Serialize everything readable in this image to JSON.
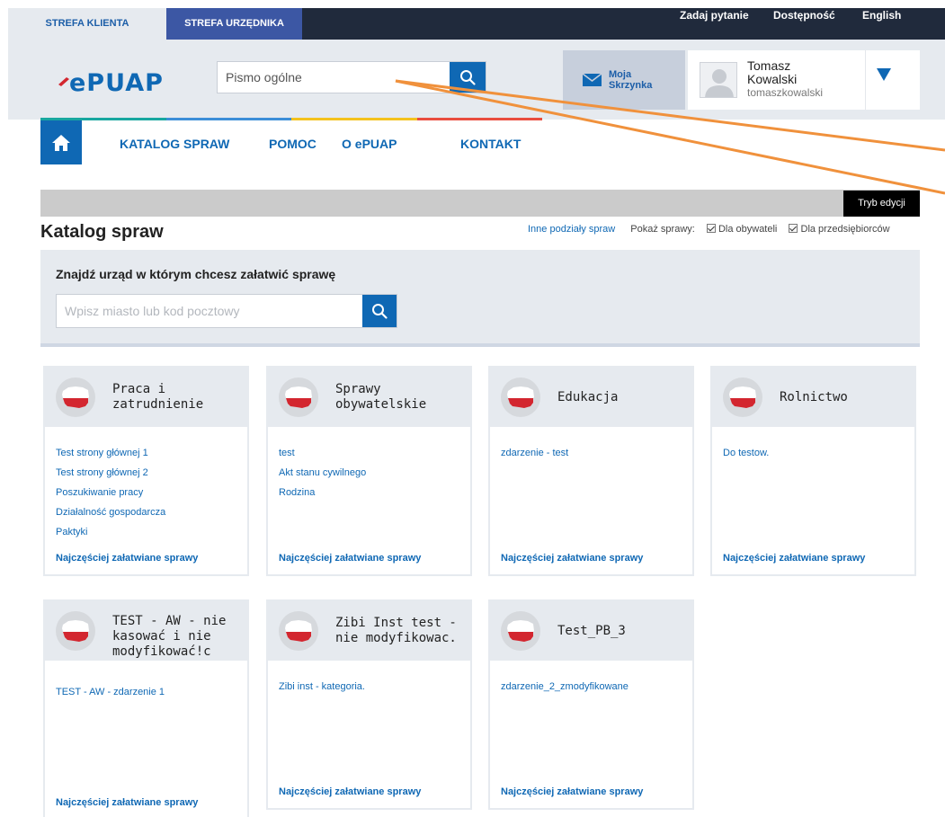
{
  "zones": {
    "klient": "STREFA KLIENTA",
    "urzednik": "STREFA URZĘDNIKA"
  },
  "top_links": {
    "ask": "Zadaj pytanie",
    "accessibility": "Dostępność",
    "english": "English"
  },
  "search": {
    "placeholder": "Pismo ogólne"
  },
  "mailbox": {
    "line1": "Moja",
    "line2": "Skrzynka"
  },
  "user": {
    "first_name": "Tomasz",
    "last_name": "Kowalski",
    "login": "tomaszkowalski"
  },
  "nav": {
    "catalog": "KATALOG SPRAW",
    "help": "POMOC",
    "about": "O ePUAP",
    "contact": "KONTAKT"
  },
  "edit_mode": "Tryb edycji",
  "page_title": "Katalog spraw",
  "filters": {
    "other": "Inne podziały spraw",
    "show": "Pokaż sprawy:",
    "citizens": "Dla obywateli",
    "business": "Dla przedsiębiorców"
  },
  "finder": {
    "title": "Znajdź urząd w którym chcesz załatwić sprawę",
    "placeholder": "Wpisz miasto lub kod pocztowy"
  },
  "colors": {
    "primary": "#0f68b4",
    "topbar": "#202a3c",
    "header": "#e6eaef",
    "flag_red": "#d3262f",
    "arrow": "#f0913c"
  },
  "cards": [
    {
      "title": "Praca i zatrudnienie",
      "links": [
        "Test strony głównej 1",
        "Test strony głównej 2",
        "Poszukiwanie pracy",
        "Działalność gospodarcza",
        "Paktyki"
      ],
      "footer": "Najczęściej załatwiane sprawy"
    },
    {
      "title": "Sprawy obywatelskie",
      "links": [
        "test",
        "Akt stanu cywilnego",
        "Rodzina"
      ],
      "footer": "Najczęściej załatwiane sprawy"
    },
    {
      "title": "Edukacja",
      "links": [
        "zdarzenie - test"
      ],
      "footer": "Najczęściej załatwiane sprawy"
    },
    {
      "title": "Rolnictwo",
      "links": [
        "Do testow."
      ],
      "footer": "Najczęściej załatwiane sprawy"
    },
    {
      "title": "TEST - AW - nie kasować i nie modyfikować!c",
      "links": [
        "TEST - AW - zdarzenie 1"
      ],
      "footer": "Najczęściej załatwiane sprawy"
    },
    {
      "title": "Zibi Inst test - nie modyfikowac.",
      "links": [
        "Zibi inst - kategoria."
      ],
      "footer": "Najczęściej załatwiane sprawy"
    },
    {
      "title": "Test_PB_3",
      "links": [
        "zdarzenie_2_zmodyfikowane"
      ],
      "footer": "Najczęściej załatwiane sprawy"
    }
  ]
}
